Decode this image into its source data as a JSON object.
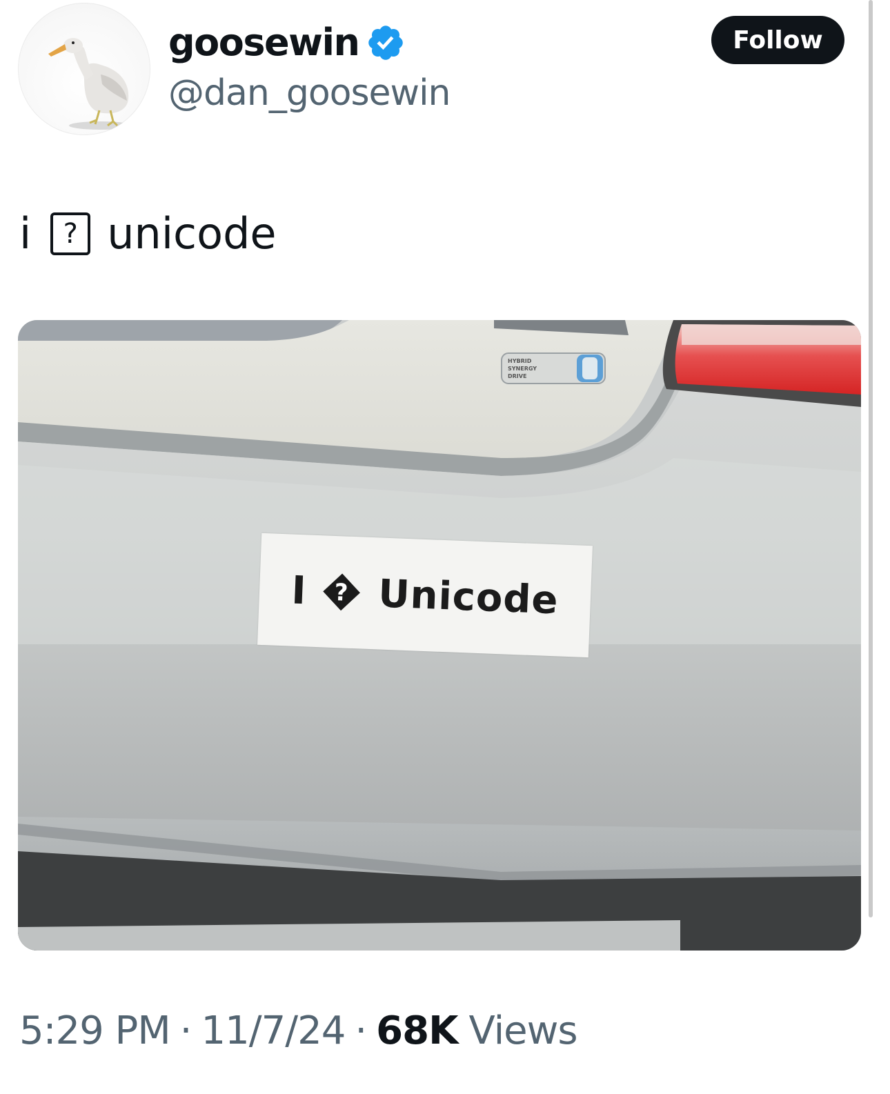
{
  "author": {
    "display_name": "goosewin",
    "handle": "@dan_goosewin",
    "verified": true,
    "avatar_icon": "goose-icon"
  },
  "actions": {
    "follow_label": "Follow"
  },
  "tweet": {
    "text_before": "i",
    "text_glyph": "?",
    "text_after": "unicode"
  },
  "media": {
    "sticker_prefix": "I",
    "sticker_glyph": "?",
    "sticker_word": "Unicode",
    "emblem_lines": [
      "HYBRID",
      "SYNERGY",
      "DRIVE"
    ]
  },
  "meta": {
    "time": "5:29 PM",
    "date": "11/7/24",
    "separator": "·",
    "views_count": "68K",
    "views_label": "Views"
  },
  "colors": {
    "text_primary": "#0f1419",
    "text_secondary": "#536471",
    "verified_blue": "#1d9bf0",
    "follow_bg": "#0f1419"
  }
}
